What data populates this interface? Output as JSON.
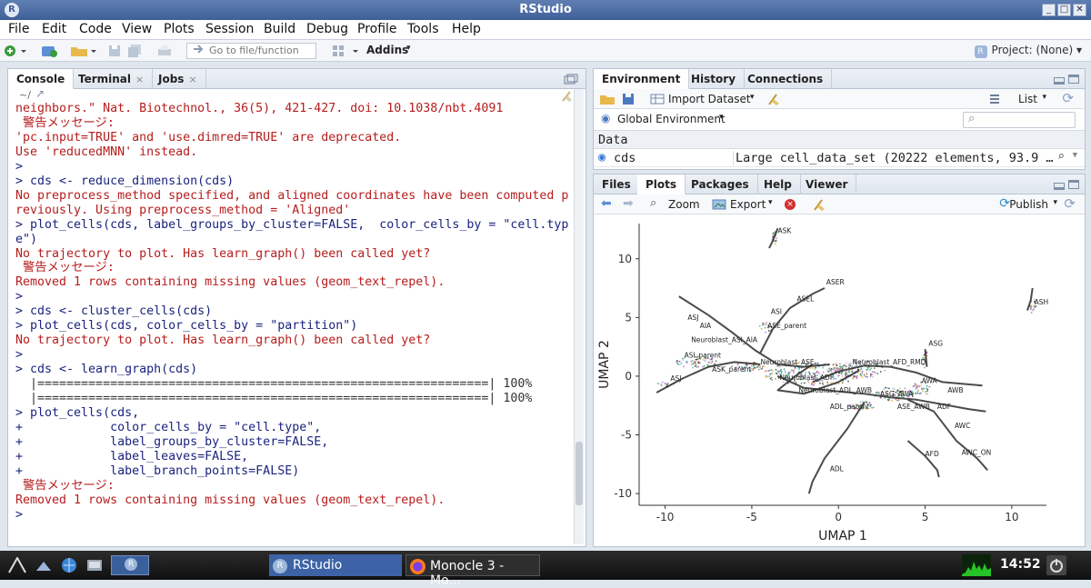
{
  "window": {
    "title": "RStudio",
    "app_icon": "R"
  },
  "menu": [
    "File",
    "Edit",
    "Code",
    "View",
    "Plots",
    "Session",
    "Build",
    "Debug",
    "Profile",
    "Tools",
    "Help"
  ],
  "toolbar": {
    "goto_placeholder": "Go to file/function",
    "addins_label": "Addins",
    "project_label": "Project: (None)"
  },
  "console": {
    "tabs": [
      {
        "label": "Console",
        "closable": false
      },
      {
        "label": "Terminal",
        "closable": true
      },
      {
        "label": "Jobs",
        "closable": true
      }
    ],
    "path": "~/",
    "lines": [
      {
        "t": "output",
        "s": "neighbors.\" Nat. Biotechnol., 36(5), 421-427. doi: 10.1038/nbt.4091"
      },
      {
        "t": "output",
        "s": " 警告メッセージ:"
      },
      {
        "t": "output",
        "s": "'pc.input=TRUE' and 'use.dimred=TRUE' are deprecated."
      },
      {
        "t": "output",
        "s": "Use 'reducedMNN' instead."
      },
      {
        "t": "input",
        "s": ">"
      },
      {
        "t": "input",
        "s": "> cds <- reduce_dimension(cds)"
      },
      {
        "t": "output",
        "s": "No preprocess_method specified, and aligned coordinates have been computed p"
      },
      {
        "t": "output",
        "s": "reviously. Using preprocess_method = 'Aligned'"
      },
      {
        "t": "input",
        "s": "> plot_cells(cds, label_groups_by_cluster=FALSE,  color_cells_by = \"cell.typ"
      },
      {
        "t": "input",
        "s": "e\")"
      },
      {
        "t": "output",
        "s": "No trajectory to plot. Has learn_graph() been called yet?"
      },
      {
        "t": "output",
        "s": " 警告メッセージ:"
      },
      {
        "t": "output",
        "s": "Removed 1 rows containing missing values (geom_text_repel)."
      },
      {
        "t": "input",
        "s": ">"
      },
      {
        "t": "input",
        "s": "> cds <- cluster_cells(cds)"
      },
      {
        "t": "input",
        "s": "> plot_cells(cds, color_cells_by = \"partition\")"
      },
      {
        "t": "output",
        "s": "No trajectory to plot. Has learn_graph() been called yet?"
      },
      {
        "t": "input",
        "s": ">"
      },
      {
        "t": "input",
        "s": "> cds <- learn_graph(cds)"
      },
      {
        "t": "plain",
        "s": "  |==============================================================| 100%"
      },
      {
        "t": "plain",
        "s": "  |==============================================================| 100%"
      },
      {
        "t": "input",
        "s": "> plot_cells(cds,"
      },
      {
        "t": "input",
        "s": "+            color_cells_by = \"cell.type\","
      },
      {
        "t": "input",
        "s": "+            label_groups_by_cluster=FALSE,"
      },
      {
        "t": "input",
        "s": "+            label_leaves=FALSE,"
      },
      {
        "t": "input",
        "s": "+            label_branch_points=FALSE)"
      },
      {
        "t": "output",
        "s": " 警告メッセージ:"
      },
      {
        "t": "output",
        "s": "Removed 1 rows containing missing values (geom_text_repel)."
      },
      {
        "t": "input",
        "s": ">"
      }
    ]
  },
  "environment": {
    "tabs": [
      "Environment",
      "History",
      "Connections"
    ],
    "import_label": "Import Dataset",
    "list_label": "List",
    "scope_label": "Global Environment",
    "section_label": "Data",
    "rows": [
      {
        "name": "cds",
        "value": "Large cell_data_set (20222 elements, 93.9 …"
      }
    ]
  },
  "files": {
    "tabs": [
      "Files",
      "Plots",
      "Packages",
      "Help",
      "Viewer"
    ],
    "zoom_label": "Zoom",
    "export_label": "Export",
    "publish_label": "Publish"
  },
  "chart_data": {
    "type": "scatter",
    "xlabel": "UMAP 1",
    "ylabel": "UMAP 2",
    "xlim": [
      -11.5,
      12
    ],
    "ylim": [
      -11,
      13
    ],
    "xticks": [
      -10,
      -5,
      0,
      5,
      10
    ],
    "yticks": [
      -10,
      -5,
      0,
      5,
      10
    ],
    "grid": false,
    "labels": [
      {
        "text": "ASK",
        "x": -3.5,
        "y": 12.2
      },
      {
        "text": "ASER",
        "x": -0.7,
        "y": 7.8
      },
      {
        "text": "ASH",
        "x": 11.3,
        "y": 6.1
      },
      {
        "text": "ASEL",
        "x": -2.4,
        "y": 6.4
      },
      {
        "text": "ASJ",
        "x": -8.7,
        "y": 4.8
      },
      {
        "text": "ASI",
        "x": -3.9,
        "y": 5.3
      },
      {
        "text": "AIA",
        "x": -8.0,
        "y": 4.1
      },
      {
        "text": "ASE_parent",
        "x": -4.1,
        "y": 4.1
      },
      {
        "text": "Neuroblast_ASI_AIA",
        "x": -8.5,
        "y": 2.9
      },
      {
        "text": "ASG",
        "x": 5.2,
        "y": 2.6
      },
      {
        "text": "ASI_parent",
        "x": -8.9,
        "y": 1.6
      },
      {
        "text": "Neuroblast_ASE",
        "x": -4.5,
        "y": 1.0
      },
      {
        "text": "Neuroblast_AFD_RMD",
        "x": 0.8,
        "y": 1.0
      },
      {
        "text": "ASK_parent",
        "x": -7.3,
        "y": 0.4
      },
      {
        "text": "ASJ",
        "x": -9.7,
        "y": -0.4
      },
      {
        "text": "AWA",
        "x": 4.8,
        "y": -0.6
      },
      {
        "text": "Neuroblast_ADF",
        "x": -3.4,
        "y": -0.3
      },
      {
        "text": "Neuroblast_ADL_AWB",
        "x": -2.3,
        "y": -1.4
      },
      {
        "text": "AWB",
        "x": 6.3,
        "y": -1.4
      },
      {
        "text": "ASG_AWA",
        "x": 2.4,
        "y": -1.7
      },
      {
        "text": "ADF",
        "x": 5.7,
        "y": -2.8
      },
      {
        "text": "ADL_parent",
        "x": -0.5,
        "y": -2.8
      },
      {
        "text": "ASE_AWB",
        "x": 3.4,
        "y": -2.8
      },
      {
        "text": "AWC",
        "x": 6.7,
        "y": -4.4
      },
      {
        "text": "AWC_ON",
        "x": 7.1,
        "y": -6.7
      },
      {
        "text": "AFD",
        "x": 5.0,
        "y": -6.8
      },
      {
        "text": "ADL",
        "x": -0.5,
        "y": -8.1
      }
    ]
  },
  "taskbar": {
    "items": [
      {
        "label": "RStudio"
      },
      {
        "label": "Monocle 3 - Mo..."
      }
    ],
    "clock": "14:52"
  },
  "colors": {
    "input": "#1a237e",
    "output": "#b71c1c",
    "titlebar": "#4a6aa5",
    "trajectory": "#2b2b2b"
  }
}
